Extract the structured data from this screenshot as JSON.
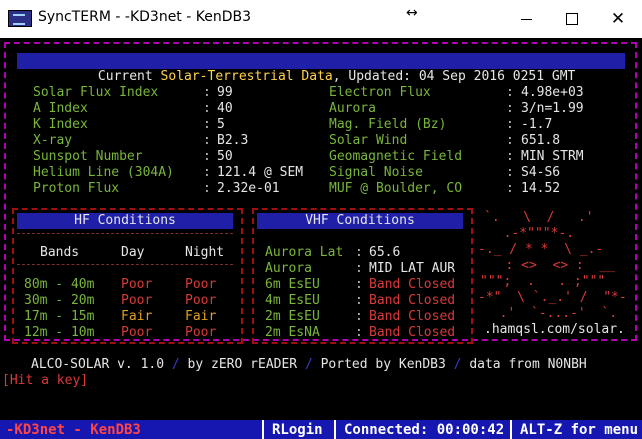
{
  "window": {
    "title": "SyncTERM - -KD3net - KenDB3",
    "resize_glyph": "↔",
    "controls": [
      "minimize",
      "maximize",
      "close"
    ]
  },
  "header": {
    "prefix": "Current ",
    "highlight": "Solar-Terrestrial Data",
    "suffix": ", Updated: 04 Sep 2016 0251 GMT"
  },
  "solar_left": [
    {
      "label": "Solar Flux Index",
      "value": "99"
    },
    {
      "label": "A Index",
      "value": "40"
    },
    {
      "label": "K Index",
      "value": "5"
    },
    {
      "label": "X-ray",
      "value": "B2.3"
    },
    {
      "label": "Sunspot Number",
      "value": "50"
    },
    {
      "label": "Helium Line (304A)",
      "value": "121.4 @ SEM"
    },
    {
      "label": "Proton Flux",
      "value": "2.32e-01"
    }
  ],
  "solar_right": [
    {
      "label": "Electron Flux",
      "value": "4.98e+03"
    },
    {
      "label": "Aurora",
      "value": "3/n=1.99"
    },
    {
      "label": "Mag. Field (Bz)",
      "value": "-1.7"
    },
    {
      "label": "Solar Wind",
      "value": "651.8"
    },
    {
      "label": "Geomagnetic Field",
      "value": "MIN STRM"
    },
    {
      "label": "Signal Noise",
      "value": "S4-S6"
    },
    {
      "label": "MUF @ Boulder, CO",
      "value": "14.52"
    }
  ],
  "hf": {
    "title": "HF Conditions",
    "headers": [
      "Bands",
      "Day",
      "Night"
    ],
    "rows": [
      {
        "band": "80m - 40m",
        "day": "Poor",
        "night": "Poor"
      },
      {
        "band": "30m - 20m",
        "day": "Poor",
        "night": "Poor"
      },
      {
        "band": "17m - 15m",
        "day": "Fair",
        "night": "Fair"
      },
      {
        "band": "12m - 10m",
        "day": "Poor",
        "night": "Poor"
      }
    ]
  },
  "vhf": {
    "title": "VHF Conditions",
    "aurora_lat_label": "Aurora Lat",
    "aurora_lat_value": "65.6",
    "aurora_label": "Aurora",
    "aurora_value": "MID LAT AUR",
    "rows": [
      {
        "label": "6m EsEU",
        "value": "Band Closed"
      },
      {
        "label": "4m EsEU",
        "value": "Band Closed"
      },
      {
        "label": "2m EsEU",
        "value": "Band Closed"
      },
      {
        "label": "2m EsNA",
        "value": "Band Closed"
      }
    ]
  },
  "art": {
    "lines": [
      "`.   \\  /   .'",
      "  .-*\"\"\"*-. ",
      "-._ / * *  \\ _.-",
      "   : <>  <> :  __",
      "\"\"\";  .   . ;\"\"\"",
      "-*\"  \\ `._.' /  \"*-",
      "  .'  `-...-'  `.",
      ".hamqsl.com/solar."
    ]
  },
  "credits": {
    "name": "ALCO-SOLAR v. 1.0",
    "by": "by zERO rEADER",
    "ported": "Ported by KenDB3",
    "source": "data from N0NBH",
    "slash": "/"
  },
  "prompt": "[Hit a key]",
  "statusbar": {
    "system": "-KD3net - KenDB3",
    "protocol": "RLogin",
    "connected": "Connected: 00:00:42",
    "hint": "ALT-Z for menu"
  },
  "colors": {
    "terminal_bg": "#000000",
    "label_green": "#7ab53a",
    "value_white": "#e6e6e6",
    "poor_red": "#d83a3a",
    "fair_orange": "#e0a020",
    "bar_blue": "#1f1fa8",
    "frame_magenta": "#b000b0",
    "status_bg": "#1616b0"
  }
}
